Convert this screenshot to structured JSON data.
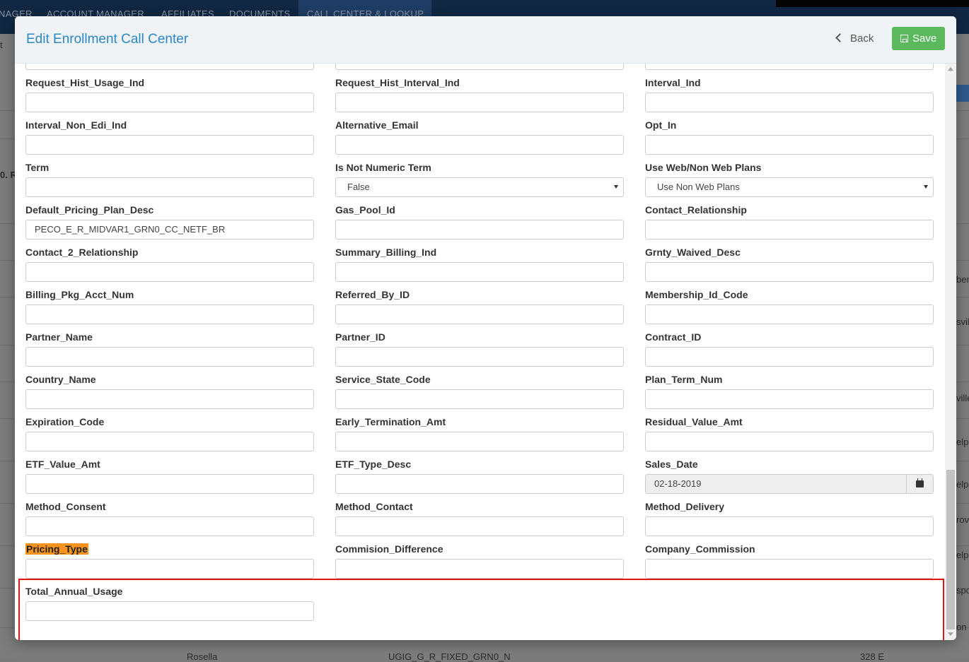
{
  "background": {
    "nav": [
      "NAGER",
      "ACCOUNT MANAGER",
      "AFFILIATES",
      "DOCUMENTS",
      "CALL CENTER & LOOKUP"
    ],
    "left_fragments": [
      "t",
      "0. R"
    ],
    "right_fragments": [
      "ber",
      "svill",
      "ville",
      "elph",
      "elph",
      "rove",
      "elph",
      "spo",
      "on"
    ],
    "bottom_row": [
      "Rosella",
      "UGIG_G_R_FIXED_GRN0_N",
      "328 E"
    ]
  },
  "modal": {
    "title": "Edit Enrollment Call Center",
    "back_label": "Back",
    "save_label": "Save"
  },
  "fields": [
    {
      "label": "Request_Hist_Usage_Ind",
      "value": ""
    },
    {
      "label": "Request_Hist_Interval_Ind",
      "value": ""
    },
    {
      "label": "Interval_Ind",
      "value": ""
    },
    {
      "label": "Interval_Non_Edi_Ind",
      "value": ""
    },
    {
      "label": "Alternative_Email",
      "value": ""
    },
    {
      "label": "Opt_In",
      "value": ""
    },
    {
      "label": "Term",
      "value": ""
    },
    {
      "label": "Is Not Numeric Term",
      "value": "False",
      "type": "select"
    },
    {
      "label": "Use Web/Non Web Plans",
      "value": "Use Non Web Plans",
      "type": "select"
    },
    {
      "label": "Default_Pricing_Plan_Desc",
      "value": "PECO_E_R_MIDVAR1_GRN0_CC_NETF_BR"
    },
    {
      "label": "Gas_Pool_Id",
      "value": ""
    },
    {
      "label": "Contact_Relationship",
      "value": ""
    },
    {
      "label": "Contact_2_Relationship",
      "value": ""
    },
    {
      "label": "Summary_Billing_Ind",
      "value": ""
    },
    {
      "label": "Grnty_Waived_Desc",
      "value": ""
    },
    {
      "label": "Billing_Pkg_Acct_Num",
      "value": ""
    },
    {
      "label": "Referred_By_ID",
      "value": ""
    },
    {
      "label": "Membership_Id_Code",
      "value": ""
    },
    {
      "label": "Partner_Name",
      "value": ""
    },
    {
      "label": "Partner_ID",
      "value": ""
    },
    {
      "label": "Contract_ID",
      "value": ""
    },
    {
      "label": "Country_Name",
      "value": ""
    },
    {
      "label": "Service_State_Code",
      "value": ""
    },
    {
      "label": "Plan_Term_Num",
      "value": ""
    },
    {
      "label": "Expiration_Code",
      "value": ""
    },
    {
      "label": "Early_Termination_Amt",
      "value": ""
    },
    {
      "label": "Residual_Value_Amt",
      "value": ""
    },
    {
      "label": "ETF_Value_Amt",
      "value": ""
    },
    {
      "label": "ETF_Type_Desc",
      "value": ""
    },
    {
      "label": "Sales_Date",
      "value": "02-18-2019",
      "type": "date"
    },
    {
      "label": "Method_Consent",
      "value": ""
    },
    {
      "label": "Method_Contact",
      "value": ""
    },
    {
      "label": "Method_Delivery",
      "value": ""
    },
    {
      "label": "Pricing_Type",
      "value": "",
      "highlighted": true
    },
    {
      "label": "Commision_Difference",
      "value": ""
    },
    {
      "label": "Company_Commission",
      "value": ""
    },
    {
      "label": "Total_Annual_Usage",
      "value": ""
    }
  ],
  "colors": {
    "title": "#2a88c7",
    "save_button": "#5cb85c",
    "highlight_box": "#e01414",
    "label_highlight": "#f7941d"
  }
}
